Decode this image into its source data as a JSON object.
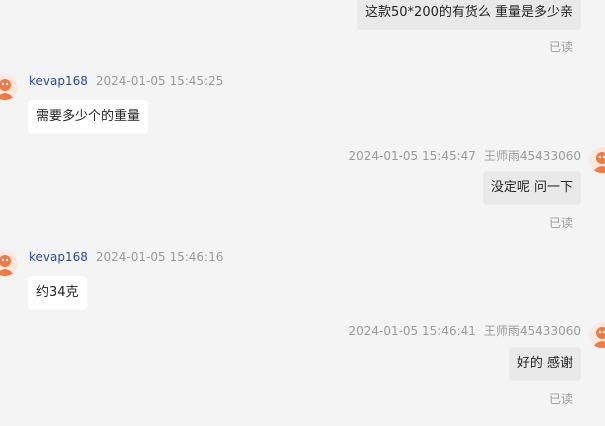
{
  "messages": [
    {
      "id": 1,
      "direction": "out",
      "text": "这款50*200的有货么  重量是多少亲",
      "read_status": "已读"
    },
    {
      "id": 2,
      "direction": "in",
      "sender": "kevap168",
      "timestamp": "2024-01-05 15:45:25",
      "text": "需要多少个的重量"
    },
    {
      "id": 3,
      "direction": "out",
      "sender": "王师雨45433060",
      "timestamp": "2024-01-05 15:45:47",
      "text": "没定呢  问一下",
      "read_status": "已读"
    },
    {
      "id": 4,
      "direction": "in",
      "sender": "kevap168",
      "timestamp": "2024-01-05 15:46:16",
      "text": "约34克"
    },
    {
      "id": 5,
      "direction": "out",
      "sender": "王师雨45433060",
      "timestamp": "2024-01-05 15:46:41",
      "text": "好的  感谢",
      "read_status": "已读"
    }
  ],
  "colors": {
    "background": "#f4f4f4",
    "outgoing_bubble": "#e9e9e9",
    "incoming_bubble": "#ffffff",
    "sender_name": "#2d4c8f",
    "meta_text": "#9a9a9a",
    "avatar": "#f07a45"
  },
  "icons": {
    "customer_avatar": "cartoon-avatar-icon",
    "agent_avatar": "cartoon-avatar-icon"
  }
}
